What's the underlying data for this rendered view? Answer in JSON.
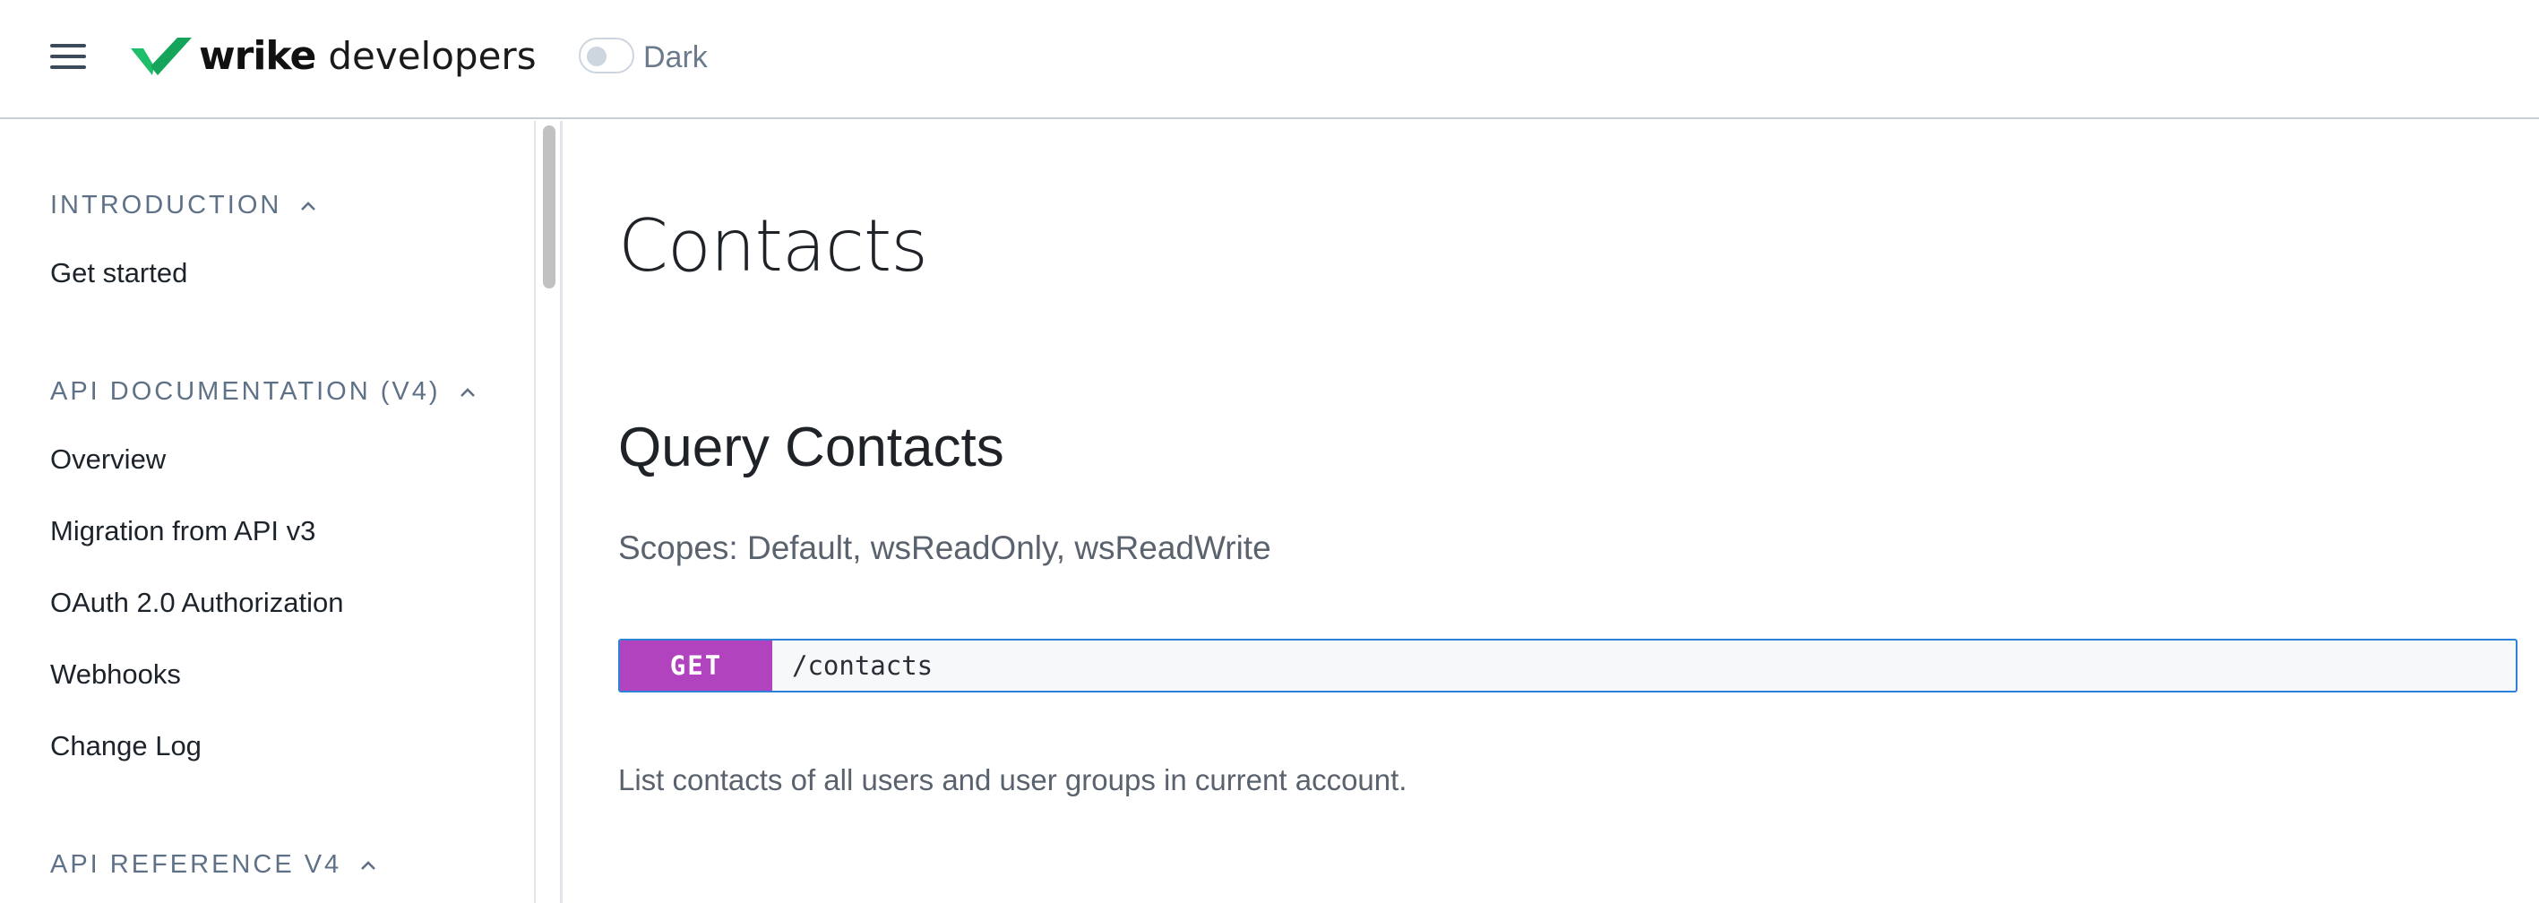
{
  "header": {
    "logo_brand": "wrike",
    "logo_suffix": "developers",
    "theme_toggle_label": "Dark",
    "theme_toggle_on": false,
    "brand_color": "#1fbe6b"
  },
  "sidebar": {
    "sections": [
      {
        "heading": "INTRODUCTION",
        "expanded": true,
        "items": [
          "Get started"
        ]
      },
      {
        "heading": "API DOCUMENTATION (V4)",
        "expanded": true,
        "items": [
          "Overview",
          "Migration from API v3",
          "OAuth 2.0 Authorization",
          "Webhooks",
          "Change Log"
        ]
      },
      {
        "heading": "API REFERENCE V4",
        "expanded": true,
        "items": []
      }
    ]
  },
  "main": {
    "title": "Contacts",
    "section_title": "Query Contacts",
    "scopes": "Scopes: Default, wsReadOnly, wsReadWrite",
    "endpoint": {
      "method": "GET",
      "path": "/contacts",
      "method_color": "#b243bf"
    },
    "description": "List contacts of all users and user groups in current account."
  }
}
